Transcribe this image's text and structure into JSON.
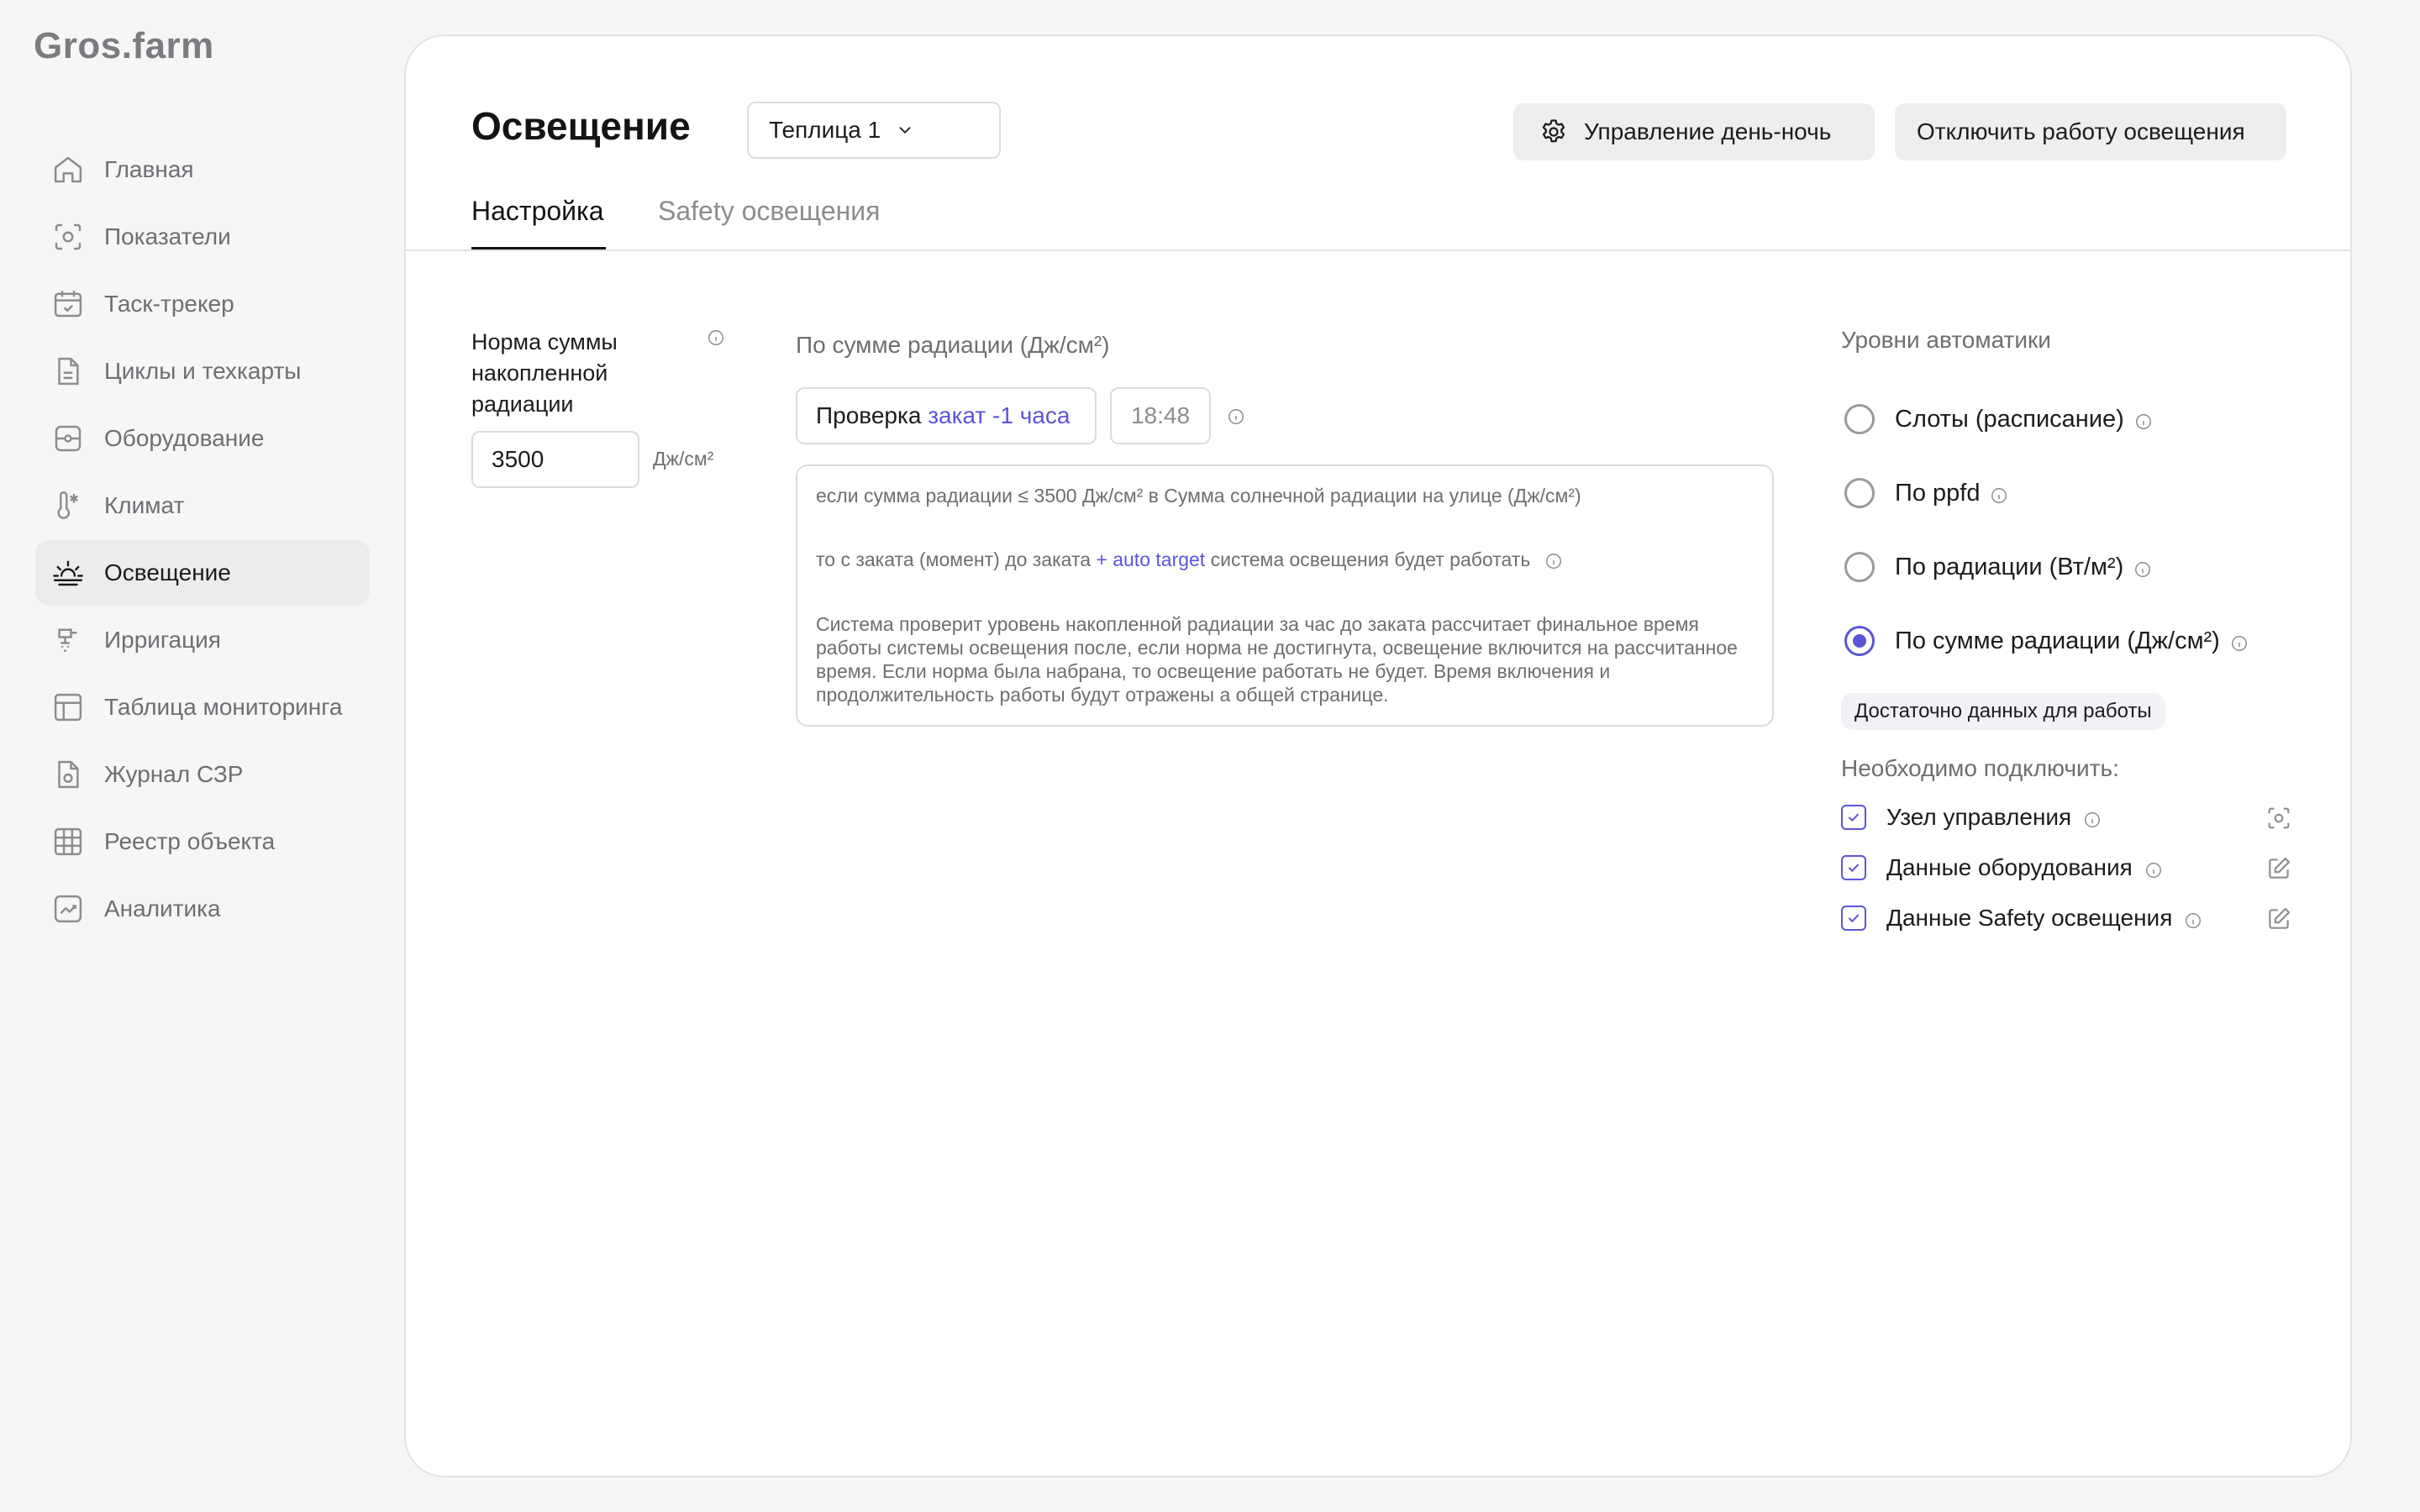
{
  "app": {
    "logo": "Gros.farm"
  },
  "sidebar": {
    "items": [
      {
        "label": "Главная",
        "icon": "home-icon"
      },
      {
        "label": "Показатели",
        "icon": "sensor-icon"
      },
      {
        "label": "Таск-трекер",
        "icon": "calendar-check-icon"
      },
      {
        "label": "Циклы и техкарты",
        "icon": "document-icon"
      },
      {
        "label": "Оборудование",
        "icon": "equipment-icon"
      },
      {
        "label": "Климат",
        "icon": "thermometer-icon"
      },
      {
        "label": "Освещение",
        "icon": "sunrise-icon",
        "active": true
      },
      {
        "label": "Ирригация",
        "icon": "irrigation-icon"
      },
      {
        "label": "Таблица мониторинга",
        "icon": "table-icon"
      },
      {
        "label": "Журнал СЗР",
        "icon": "journal-icon"
      },
      {
        "label": "Реестр объекта",
        "icon": "grid-icon"
      },
      {
        "label": "Аналитика",
        "icon": "chart-icon"
      }
    ]
  },
  "header": {
    "title": "Освещение",
    "greenhouse": "Теплица 1",
    "daynight_label": "Управление день-ночь",
    "disable_label": "Отключить работу освещения"
  },
  "tabs": {
    "setup": "Настройка",
    "safety": "Safety освещения"
  },
  "norm": {
    "label": "Нормa суммы накопленной радиации",
    "value": "3500",
    "unit": "Дж/см²"
  },
  "radiation": {
    "title": "По сумме радиации (Дж/см²)",
    "check_prefix": "Проверка",
    "check_accent": "закат -1 часа",
    "time": "18:48",
    "line1": "если сумма радиации ≤ 3500 Дж/см² в Сумма солнечной радиации на улице (Дж/см²)",
    "line2_prefix": "то с заката (момент) до заката",
    "line2_accent": "+ auto target",
    "line2_suffix": "система освещения будет работать",
    "paragraph": "Система проверит  уровень накопленной радиации за час до заката рассчитает финальное время работы системы освещения после, если норма не достигнута, освещение включится на рассчитанное время. Если норма была набрана, то освещение работать не будет. Время включения и продолжительность работы будут отражены а общей странице."
  },
  "automation": {
    "title": "Уровни автоматики",
    "options": [
      {
        "label": "Слоты (расписание)",
        "checked": false
      },
      {
        "label": "По ppfd",
        "checked": false
      },
      {
        "label": "По радиации (Вт/м²)",
        "checked": false
      },
      {
        "label": "По сумме радиации (Дж/см²)",
        "checked": true
      }
    ],
    "badge": "Достаточно данных для работы",
    "need_title": "Необходимо подключить:",
    "needs": [
      {
        "label": "Узел управления",
        "action_icon": "sensor-icon"
      },
      {
        "label": "Данные оборудования",
        "action_icon": "edit-icon"
      },
      {
        "label": "Данные Safety освещения",
        "action_icon": "edit-icon"
      }
    ]
  },
  "colors": {
    "accent": "#5b55d6",
    "text": "#1c1c1e",
    "muted": "#6e6e73",
    "border": "#dcdcdf"
  }
}
